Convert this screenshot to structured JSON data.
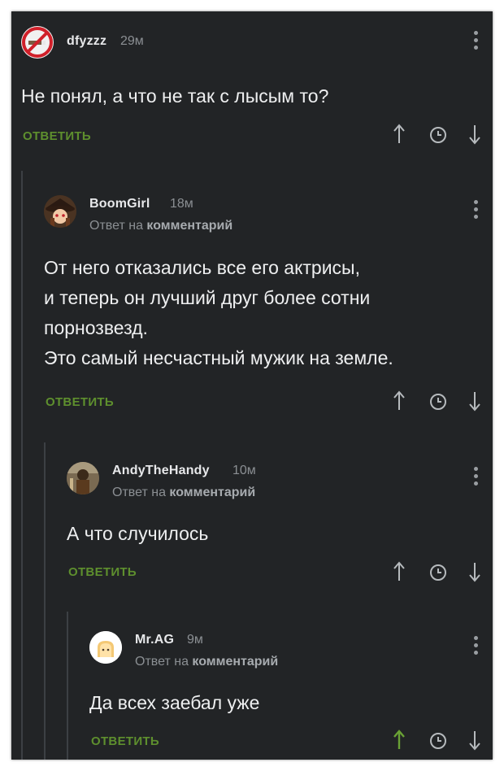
{
  "comments": [
    {
      "username": "dfyzzz",
      "time": "29м",
      "reply_prefix": "",
      "reply_target": "",
      "text": "Не понял, а что не так с лысым то?",
      "reply_label": "ОТВЕТИТЬ",
      "avatar": "no-smoking-avatar"
    },
    {
      "username": "BoomGirl",
      "time": "18м",
      "reply_prefix": "Ответ на",
      "reply_target": "комментарий",
      "text": "От него отказались все его актрисы,\nи теперь он лучший друг более сотни\nпорнозвезд.\nЭто самый несчастный мужик на земле.",
      "reply_label": "ОТВЕТИТЬ",
      "avatar": "anime-girl-avatar"
    },
    {
      "username": "AndyTheHandy",
      "time": "10м",
      "reply_prefix": "Ответ на",
      "reply_target": "комментарий",
      "text": "А что случилось",
      "reply_label": "ОТВЕТИТЬ",
      "avatar": "figure-avatar"
    },
    {
      "username": "Mr.AG",
      "time": "9м",
      "reply_prefix": "Ответ на",
      "reply_target": "комментарий",
      "text": "Да всех заебал уже",
      "reply_label": "ОТВЕТИТЬ",
      "avatar": "toast-avatar"
    }
  ],
  "icons": [
    "arrow-up-icon",
    "clock-icon",
    "arrow-down-icon",
    "more-vertical-icon"
  ],
  "colors": {
    "background": "#222426",
    "text": "#eeeff0",
    "reply_green": "#5e8f2e",
    "muted": "#8b8f93",
    "active_upvote": "#6aa235"
  }
}
